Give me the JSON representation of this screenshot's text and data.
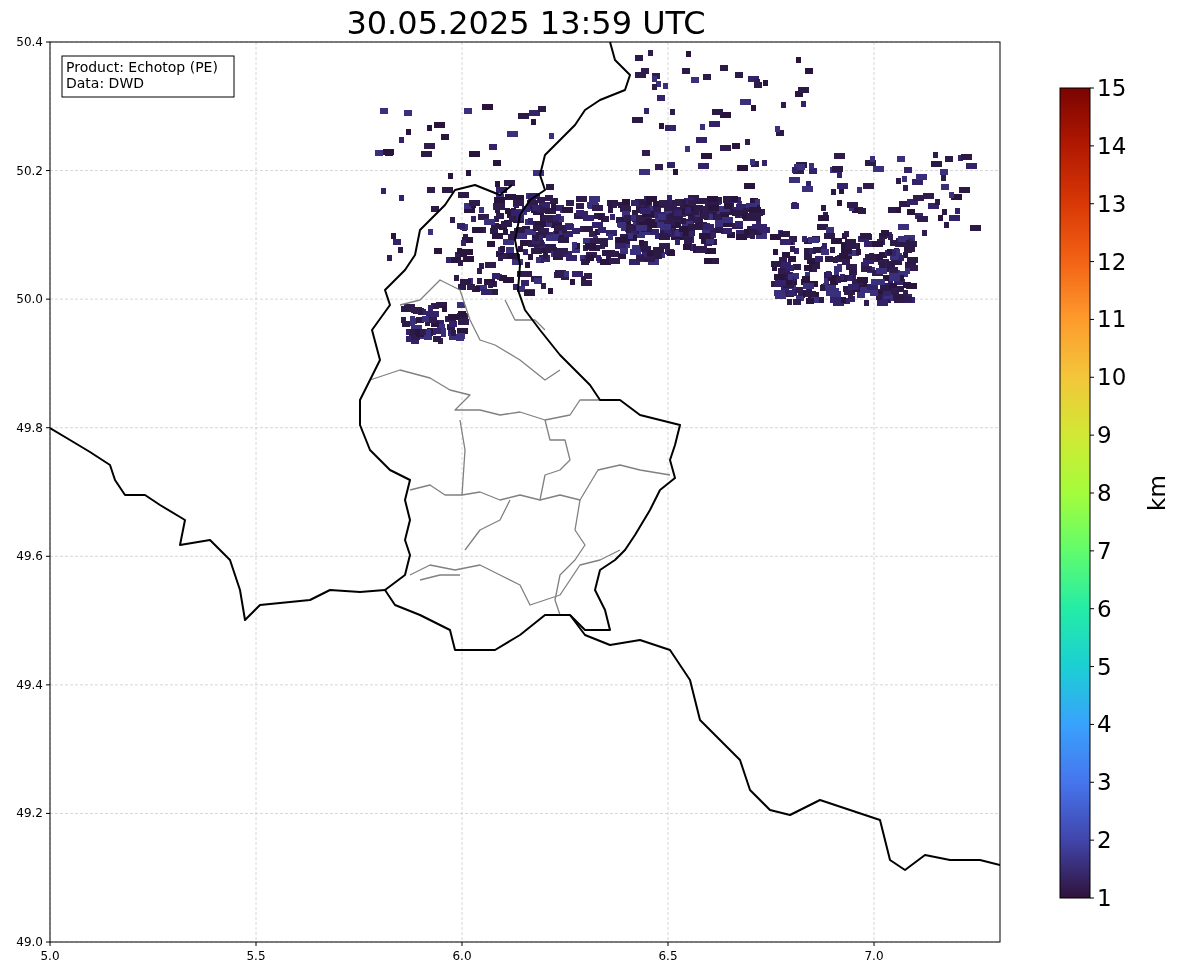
{
  "title": "30.05.2025 13:59 UTC",
  "info_box": [
    "Product: Echotop (PE)",
    "Data: DWD"
  ],
  "x_axis": {
    "ticks": [
      "5.0",
      "5.5",
      "6.0",
      "6.5",
      "7.0"
    ]
  },
  "y_axis": {
    "ticks": [
      "50.4",
      "50.2",
      "50.0",
      "49.8",
      "49.6",
      "49.4",
      "49.2",
      "49.0"
    ]
  },
  "colorbar": {
    "label": "km",
    "ticks": [
      "15",
      "14",
      "13",
      "12",
      "11",
      "10",
      "9",
      "8",
      "7",
      "6",
      "5",
      "4",
      "3",
      "2",
      "1"
    ]
  }
}
